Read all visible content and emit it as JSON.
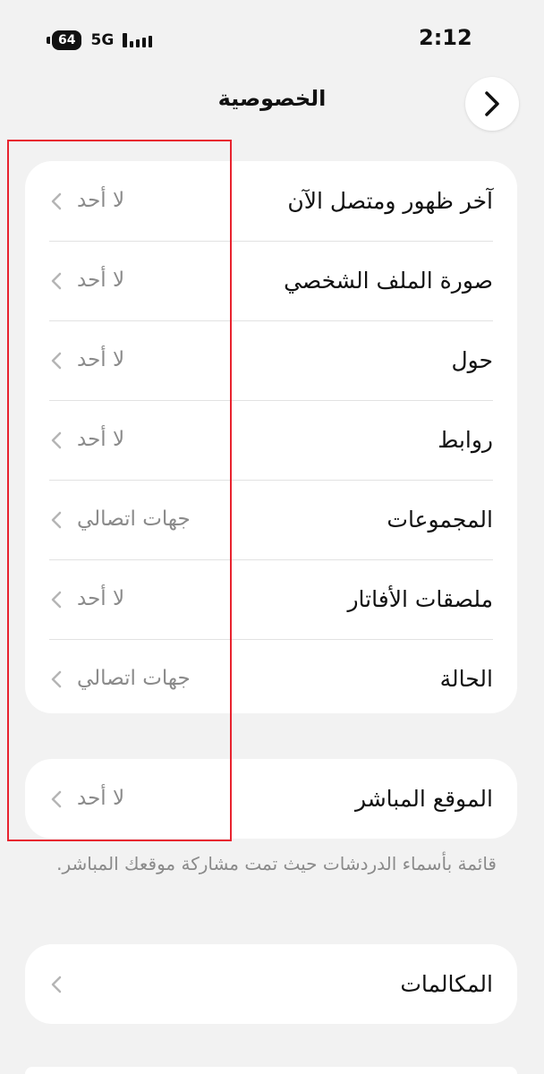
{
  "status_bar": {
    "battery": "64",
    "network": "5G",
    "time": "2:12"
  },
  "nav": {
    "title": "الخصوصية"
  },
  "privacy_rows": [
    {
      "label": "آخر ظهور ومتصل الآن",
      "value": "لا أحد"
    },
    {
      "label": "صورة الملف الشخصي",
      "value": "لا أحد"
    },
    {
      "label": "حول",
      "value": "لا أحد"
    },
    {
      "label": "روابط",
      "value": "لا أحد"
    },
    {
      "label": "المجموعات",
      "value": "جهات اتصالي"
    },
    {
      "label": "ملصقات الأفاتار",
      "value": "لا أحد"
    },
    {
      "label": "الحالة",
      "value": "جهات اتصالي"
    }
  ],
  "live_location": {
    "label": "الموقع المباشر",
    "value": "لا أحد",
    "note": "قائمة بأسماء الدردشات حيث تمت مشاركة موقعك المباشر."
  },
  "calls": {
    "label": "المكالمات"
  },
  "colors": {
    "background": "#f2f2f2",
    "card": "#ffffff",
    "secondary_text": "#8a8a8a",
    "highlight_border": "#e8232f"
  }
}
